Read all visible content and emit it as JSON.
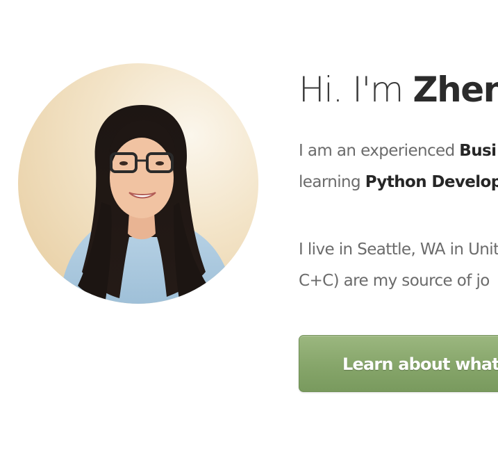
{
  "intro": {
    "greeting": "Hi. I'm",
    "name": "Zhen",
    "line1_pre": "I am an experienced",
    "line1_bold": "Busi",
    "line2_pre": "learning",
    "line2_bold": "Python Develop",
    "line3": "I live in Seattle, WA in Unit",
    "line4": "C+C) are my source of jo"
  },
  "cta": {
    "label": "Learn about what I c"
  },
  "portrait": {
    "alt": "Portrait photo",
    "icon": "person-photo"
  },
  "colors": {
    "button": "#86a56a",
    "heading": "#2f2f2f",
    "body_text": "#6b6b6b"
  }
}
